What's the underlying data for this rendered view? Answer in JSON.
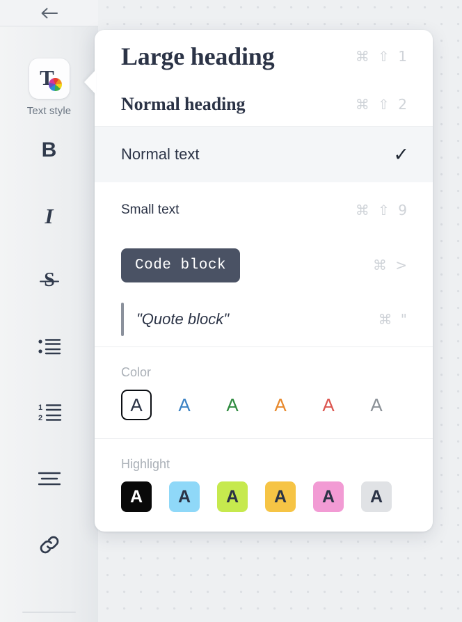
{
  "toolbar": {
    "back_label": "back-arrow",
    "text_style_label": "Text style",
    "items": [
      {
        "name": "bold",
        "glyph": "B"
      },
      {
        "name": "italic",
        "glyph": "I"
      },
      {
        "name": "strikethrough",
        "glyph": "S"
      },
      {
        "name": "bulleted-list",
        "glyph": ""
      },
      {
        "name": "numbered-list",
        "glyph": ""
      },
      {
        "name": "align",
        "glyph": ""
      },
      {
        "name": "link",
        "glyph": ""
      }
    ]
  },
  "panel": {
    "styles": [
      {
        "label": "Large heading",
        "shortcut": "⌘ ⇧ 1",
        "selected": false
      },
      {
        "label": "Normal heading",
        "shortcut": "⌘ ⇧ 2",
        "selected": false
      },
      {
        "label": "Normal text",
        "shortcut": "",
        "selected": true
      },
      {
        "label": "Small text",
        "shortcut": "⌘ ⇧ 9",
        "selected": false
      },
      {
        "label": "Code block",
        "shortcut": "⌘ >",
        "selected": false
      },
      {
        "label": "\"Quote block\"",
        "shortcut": "⌘ \"",
        "selected": false
      }
    ],
    "check_glyph": "✓",
    "color": {
      "title": "Color",
      "swatch_letter": "A",
      "swatches": [
        {
          "name": "default",
          "hex": "#2b3346",
          "active": true
        },
        {
          "name": "blue",
          "hex": "#3b82c4",
          "active": false
        },
        {
          "name": "green",
          "hex": "#2e8b3f",
          "active": false
        },
        {
          "name": "orange",
          "hex": "#e8892c",
          "active": false
        },
        {
          "name": "red",
          "hex": "#dc5650",
          "active": false
        },
        {
          "name": "gray",
          "hex": "#8b9197",
          "active": false
        }
      ]
    },
    "highlight": {
      "title": "Highlight",
      "swatch_letter": "A",
      "swatches": [
        {
          "name": "black",
          "bg": "#090909",
          "fg": "#ffffff",
          "active": false
        },
        {
          "name": "blue",
          "bg": "#8fd8f8",
          "fg": "#2b3346",
          "active": false
        },
        {
          "name": "lime",
          "bg": "#c6e94e",
          "fg": "#2b3346",
          "active": false
        },
        {
          "name": "amber",
          "bg": "#f6c445",
          "fg": "#2b3346",
          "active": false
        },
        {
          "name": "pink",
          "bg": "#f29bd4",
          "fg": "#2b3346",
          "active": false
        },
        {
          "name": "gray",
          "bg": "#e0e2e5",
          "fg": "#2b3346",
          "active": false
        }
      ]
    }
  }
}
